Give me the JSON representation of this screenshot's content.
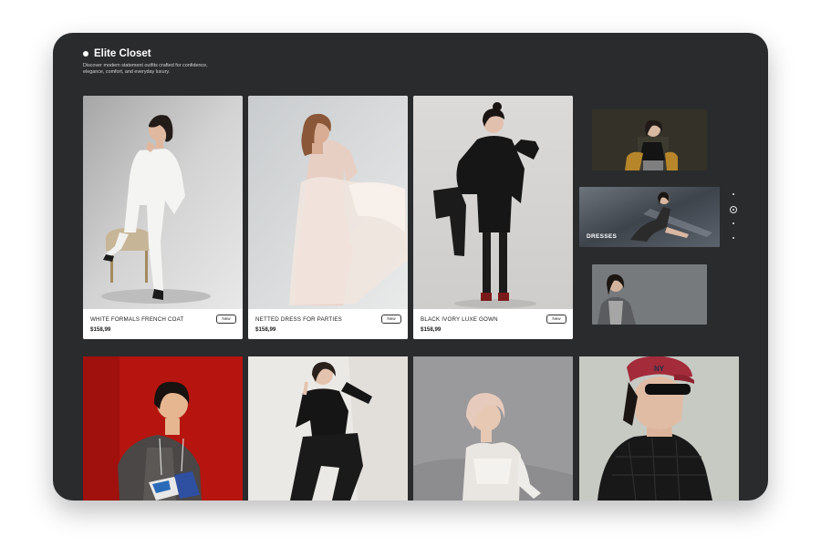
{
  "brand": {
    "name": "Elite Closet",
    "tagline": "Discover modern statement outfits crafted for confidence, elegance, comfort, and everyday luxury."
  },
  "products": [
    {
      "title": "WHITE FORMALS FRENCH COAT",
      "price": "$158,99",
      "badge": "New"
    },
    {
      "title": "NETTED DRESS FOR PARTIES",
      "price": "$158,99",
      "badge": "New"
    },
    {
      "title": "BLACK IVORY LUXE GOWN",
      "price": "$158,99",
      "badge": "New"
    }
  ],
  "carousel": {
    "active_label": "DRESSES",
    "dot_count": 4,
    "active_index": 1
  },
  "colors": {
    "frame": "#2a2b2d",
    "card": "#ffffff",
    "accent_red": "#b5140f"
  }
}
